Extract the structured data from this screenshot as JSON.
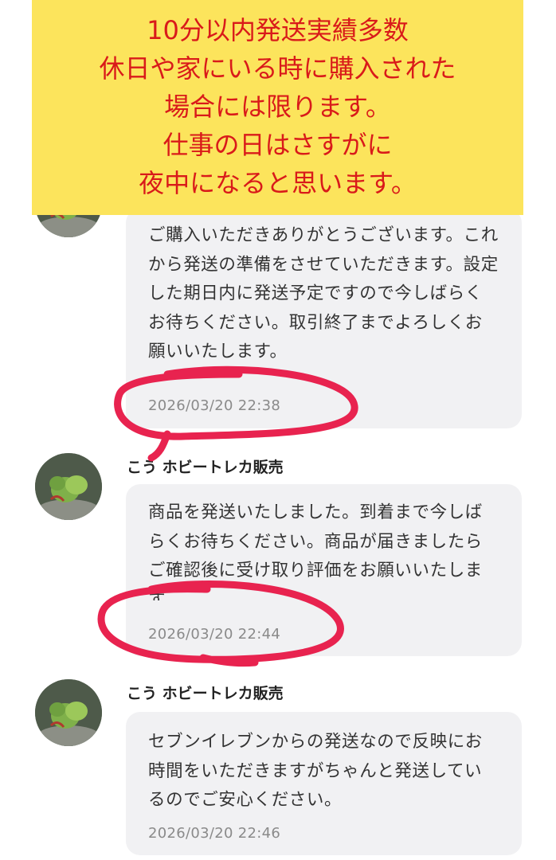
{
  "banner": {
    "lines": [
      "10分以内発送実績多数",
      "休日や家にいる時に購入された",
      "場合には限ります。",
      "仕事の日はさすがに",
      "夜中になると思います。"
    ]
  },
  "messages": [
    {
      "sender": "",
      "text": "ご購入いただきありがとうございます。これから発送の準備をさせていただきます。設定した期日内に発送予定ですので今しばらくお待ちください。取引終了までよろしくお願いいたします。",
      "time": "2026/03/20 22:38"
    },
    {
      "sender": "こう ホビートレカ販売",
      "text": "商品を発送いたしました。到着まで今しばらくお待ちください。商品が届きましたらご確認後に受け取り評価をお願いいたします。",
      "time": "2026/03/20 22:44"
    },
    {
      "sender": "こう ホビートレカ販売",
      "text": "セブンイレブンからの発送なので反映にお時間をいただきますがちゃんと発送しているのでご安心ください。",
      "time": "2026/03/20 22:46"
    }
  ],
  "colors": {
    "banner_bg": "#fce45c",
    "banner_text": "#d91a1a",
    "bubble_bg": "#f1f1f3",
    "annotation_marker": "#e8234f"
  }
}
